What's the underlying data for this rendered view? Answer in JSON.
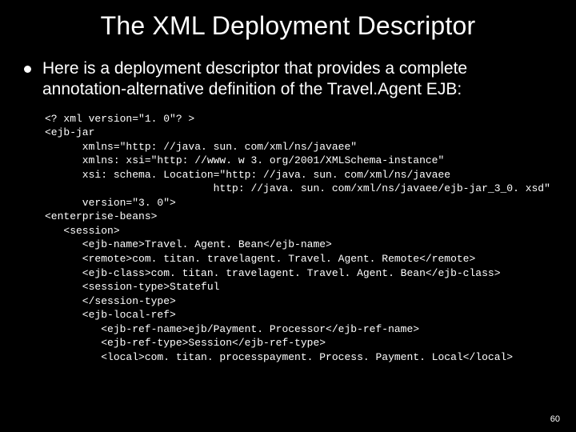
{
  "title": "The XML Deployment Descriptor",
  "body": "Here is a deployment descriptor that provides a complete annotation-alternative definition of the Travel.Agent EJB:",
  "code": "<? xml version=\"1. 0\"? >\n<ejb-jar\n      xmlns=\"http: //java. sun. com/xml/ns/javaee\"\n      xmlns: xsi=\"http: //www. w 3. org/2001/XMLSchema-instance\"\n      xsi: schema. Location=\"http: //java. sun. com/xml/ns/javaee\n                           http: //java. sun. com/xml/ns/javaee/ejb-jar_3_0. xsd\"\n      version=\"3. 0\">\n<enterprise-beans>\n   <session>\n      <ejb-name>Travel. Agent. Bean</ejb-name>\n      <remote>com. titan. travelagent. Travel. Agent. Remote</remote>\n      <ejb-class>com. titan. travelagent. Travel. Agent. Bean</ejb-class>\n      <session-type>Stateful\n      </session-type>\n      <ejb-local-ref>\n         <ejb-ref-name>ejb/Payment. Processor</ejb-ref-name>\n         <ejb-ref-type>Session</ejb-ref-type>\n         <local>com. titan. processpayment. Process. Payment. Local</local>",
  "page_number": "60"
}
